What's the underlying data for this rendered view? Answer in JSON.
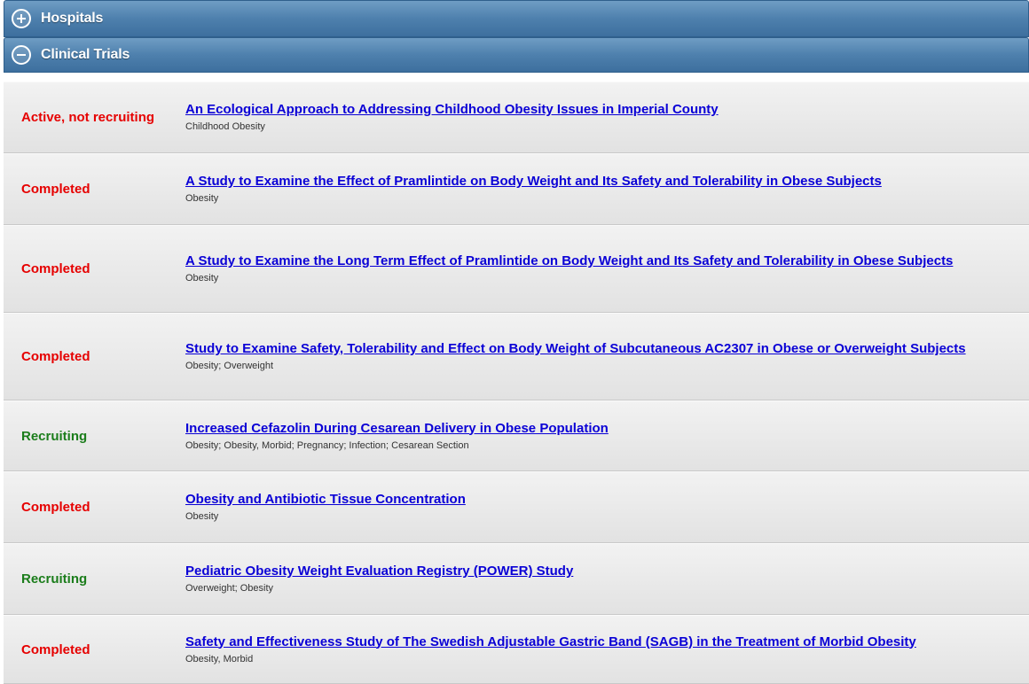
{
  "accordion": {
    "hospitals_label": "Hospitals",
    "clinical_trials_label": "Clinical Trials"
  },
  "trials": [
    {
      "status": "Active, not recruiting",
      "status_color": "#e60000",
      "title": "An Ecological Approach to Addressing Childhood Obesity Issues in Imperial County",
      "conditions": "Childhood Obesity"
    },
    {
      "status": "Completed",
      "status_color": "#e60000",
      "title": "A Study to Examine the Effect of Pramlintide on Body Weight and Its Safety and Tolerability in Obese Subjects",
      "conditions": "Obesity"
    },
    {
      "status": "Completed",
      "status_color": "#e60000",
      "title": "A Study to Examine the Long Term Effect of Pramlintide on Body Weight and Its Safety and Tolerability in Obese Subjects",
      "conditions": "Obesity"
    },
    {
      "status": "Completed",
      "status_color": "#e60000",
      "title": "Study to Examine Safety, Tolerability and Effect on Body Weight of Subcutaneous AC2307 in Obese or Overweight Subjects",
      "conditions": "Obesity; Overweight"
    },
    {
      "status": "Recruiting",
      "status_color": "#1b7d1b",
      "title": "Increased Cefazolin During Cesarean Delivery in Obese Population",
      "conditions": "Obesity; Obesity, Morbid; Pregnancy; Infection; Cesarean Section"
    },
    {
      "status": "Completed",
      "status_color": "#e60000",
      "title": "Obesity and Antibiotic Tissue Concentration",
      "conditions": "Obesity"
    },
    {
      "status": "Recruiting",
      "status_color": "#1b7d1b",
      "title": "Pediatric Obesity Weight Evaluation Registry (POWER) Study",
      "conditions": "Overweight; Obesity"
    },
    {
      "status": "Completed",
      "status_color": "#e60000",
      "title": "Safety and Effectiveness Study of The Swedish Adjustable Gastric Band (SAGB) in the Treatment of Morbid Obesity",
      "conditions": "Obesity, Morbid"
    }
  ]
}
